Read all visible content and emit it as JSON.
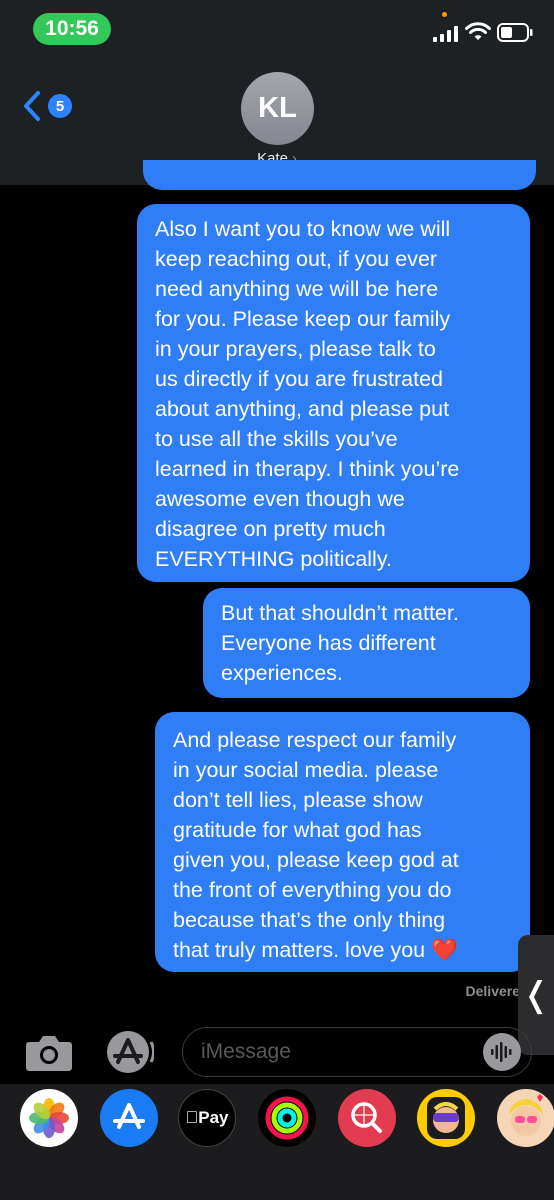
{
  "status_bar": {
    "time": "10:56"
  },
  "nav": {
    "back_badge": "5",
    "avatar_initials": "KL",
    "contact_name": "Kate",
    "contact_chevron": "›"
  },
  "messages": [
    {
      "id": "msg-1",
      "text": "Also I want you to know we will\nkeep reaching out, if you ever\nneed anything we will be here\nfor you. Please keep our family\nin your prayers, please talk to\nus directly if you are frustrated\nabout anything, and please put\nto use all the skills you’ve\nlearned in therapy. I think you’re\nawesome even though we\ndisagree on pretty much\nEVERYTHING politically."
    },
    {
      "id": "msg-2",
      "text": "But that shouldn’t matter.\nEveryone has different\nexperiences."
    },
    {
      "id": "msg-3",
      "text": "And please respect our family\nin your social media. please\ndon’t tell lies, please show\ngratitude for what god has\ngiven you, please keep god at\nthe front of everything you do\nbecause that’s the only thing\nthat truly matters. love you ❤️"
    }
  ],
  "delivery_status": "Delivere",
  "side_tab_glyph": "❬",
  "input": {
    "placeholder": "iMessage"
  },
  "app_drawer": {
    "apps": [
      {
        "name": "photos-icon"
      },
      {
        "name": "app-store-icon"
      },
      {
        "name": "apple-pay-icon",
        "label": "Pay"
      },
      {
        "name": "activity-icon"
      },
      {
        "name": "image-search-icon"
      },
      {
        "name": "memoji-icon"
      },
      {
        "name": "memoji-stickers-icon"
      }
    ]
  },
  "colors": {
    "bubble": "#2f7ef6",
    "header": "#1e2124",
    "time_pill": "#34c759",
    "badge": "#2c83ff"
  }
}
